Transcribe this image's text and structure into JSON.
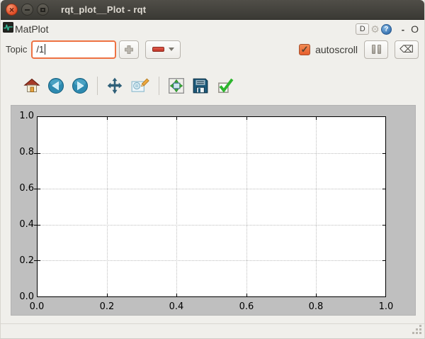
{
  "window": {
    "title": "rqt_plot__Plot - rqt",
    "controls": {
      "close": "×",
      "minimize": "bar",
      "maximize": "square"
    }
  },
  "dock_header": {
    "title": "MatPlot",
    "d_button_label": "D",
    "gear_icon": "⚙",
    "help_icon": "?",
    "float_glyph": "-",
    "close_glyph": "O"
  },
  "topic_bar": {
    "label": "Topic",
    "input_value": "/1",
    "autoscroll_label": "autoscroll",
    "check_icon": "✓",
    "clear_icon": "⌫"
  },
  "toolbar_icons": [
    "home",
    "back",
    "forward",
    "pan",
    "zoom-edit",
    "subplots",
    "save",
    "customize-check"
  ],
  "chart_data": {
    "type": "line",
    "title": "",
    "xlabel": "",
    "ylabel": "",
    "xlim": [
      0.0,
      1.0
    ],
    "ylim": [
      0.0,
      1.0
    ],
    "xtick_labels": [
      "0.0",
      "0.2",
      "0.4",
      "0.6",
      "0.8",
      "1.0"
    ],
    "ytick_labels_top_to_bottom": [
      "1.0",
      "0.8",
      "0.6",
      "0.4",
      "0.2",
      "0.0"
    ],
    "grid": true,
    "series": []
  },
  "colors": {
    "titlebar_bg": "#3c3b37",
    "close_button": "#e25029",
    "window_bg": "#f0efeb",
    "focus_ring": "#ee7243",
    "checkbox_checked": "#e8602f",
    "minus_bar": "#c83c31",
    "help_blue": "#3c76b3",
    "figure_bg": "#bfbfbf",
    "axes_bg": "#ffffff"
  }
}
